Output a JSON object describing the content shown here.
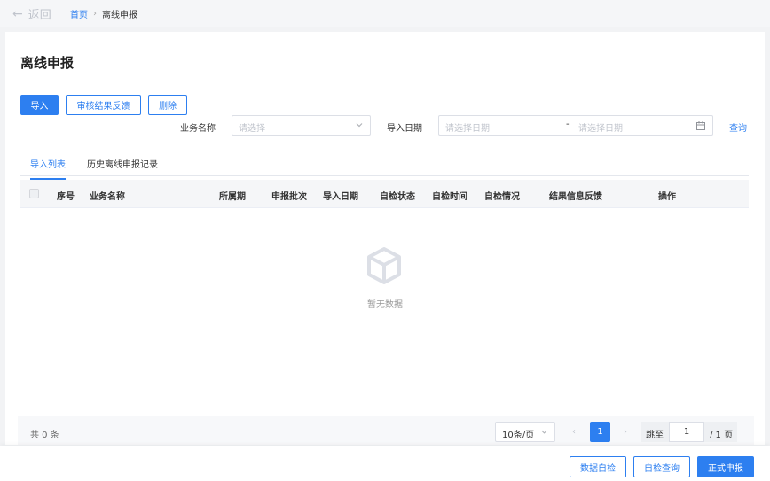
{
  "nav": {
    "back_label": "返回",
    "breadcrumb_home": "首页",
    "breadcrumb_current": "离线申报"
  },
  "page": {
    "title": "离线申报"
  },
  "toolbar": {
    "import_label": "导入",
    "feedback_label": "审核结果反馈",
    "delete_label": "删除"
  },
  "filters": {
    "business_label": "业务名称",
    "business_placeholder": "请选择",
    "date_label": "导入日期",
    "date_start_placeholder": "请选择日期",
    "date_separator": "-",
    "date_end_placeholder": "请选择日期",
    "query_label": "查询"
  },
  "tabs": [
    {
      "label": "导入列表",
      "active": true
    },
    {
      "label": "历史离线申报记录",
      "active": false
    }
  ],
  "table": {
    "columns": [
      "序号",
      "业务名称",
      "所属期",
      "申报批次",
      "导入日期",
      "自检状态",
      "自检时间",
      "自检情况",
      "结果信息反馈",
      "操作"
    ],
    "rows": [],
    "empty_text": "暂无数据"
  },
  "pagination": {
    "total_text": "共 0 条",
    "page_size": "10条/页",
    "prev_icon": "‹",
    "next_icon": "›",
    "current_page": "1",
    "jump_label": "跳至",
    "jump_value": "1",
    "total_pages_text": "/ 1 页"
  },
  "footer": {
    "data_check_label": "数据自检",
    "check_query_label": "自检查询",
    "submit_label": "正式申报"
  },
  "colors": {
    "primary": "#2d7ff0",
    "placeholder": "#c0c4cc",
    "header_bg": "#f5f6f8"
  }
}
